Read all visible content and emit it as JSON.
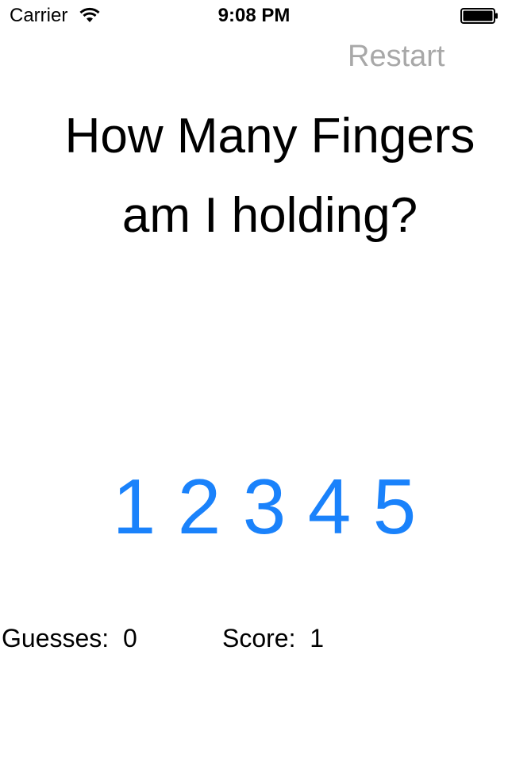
{
  "status_bar": {
    "carrier": "Carrier",
    "time": "9:08 PM",
    "wifi_icon": "wifi-icon",
    "battery_icon": "battery-icon"
  },
  "header": {
    "restart_label": "Restart"
  },
  "question": {
    "line1": "How Many Fingers",
    "line2": "am I holding?"
  },
  "choices": [
    "1",
    "2",
    "3",
    "4",
    "5"
  ],
  "stats": {
    "guesses_label": "Guesses:  0",
    "score_label": "Score:  1"
  },
  "colors": {
    "accent": "#1a82fb",
    "restart": "#a8a8a8",
    "text": "#000000",
    "background": "#ffffff"
  }
}
